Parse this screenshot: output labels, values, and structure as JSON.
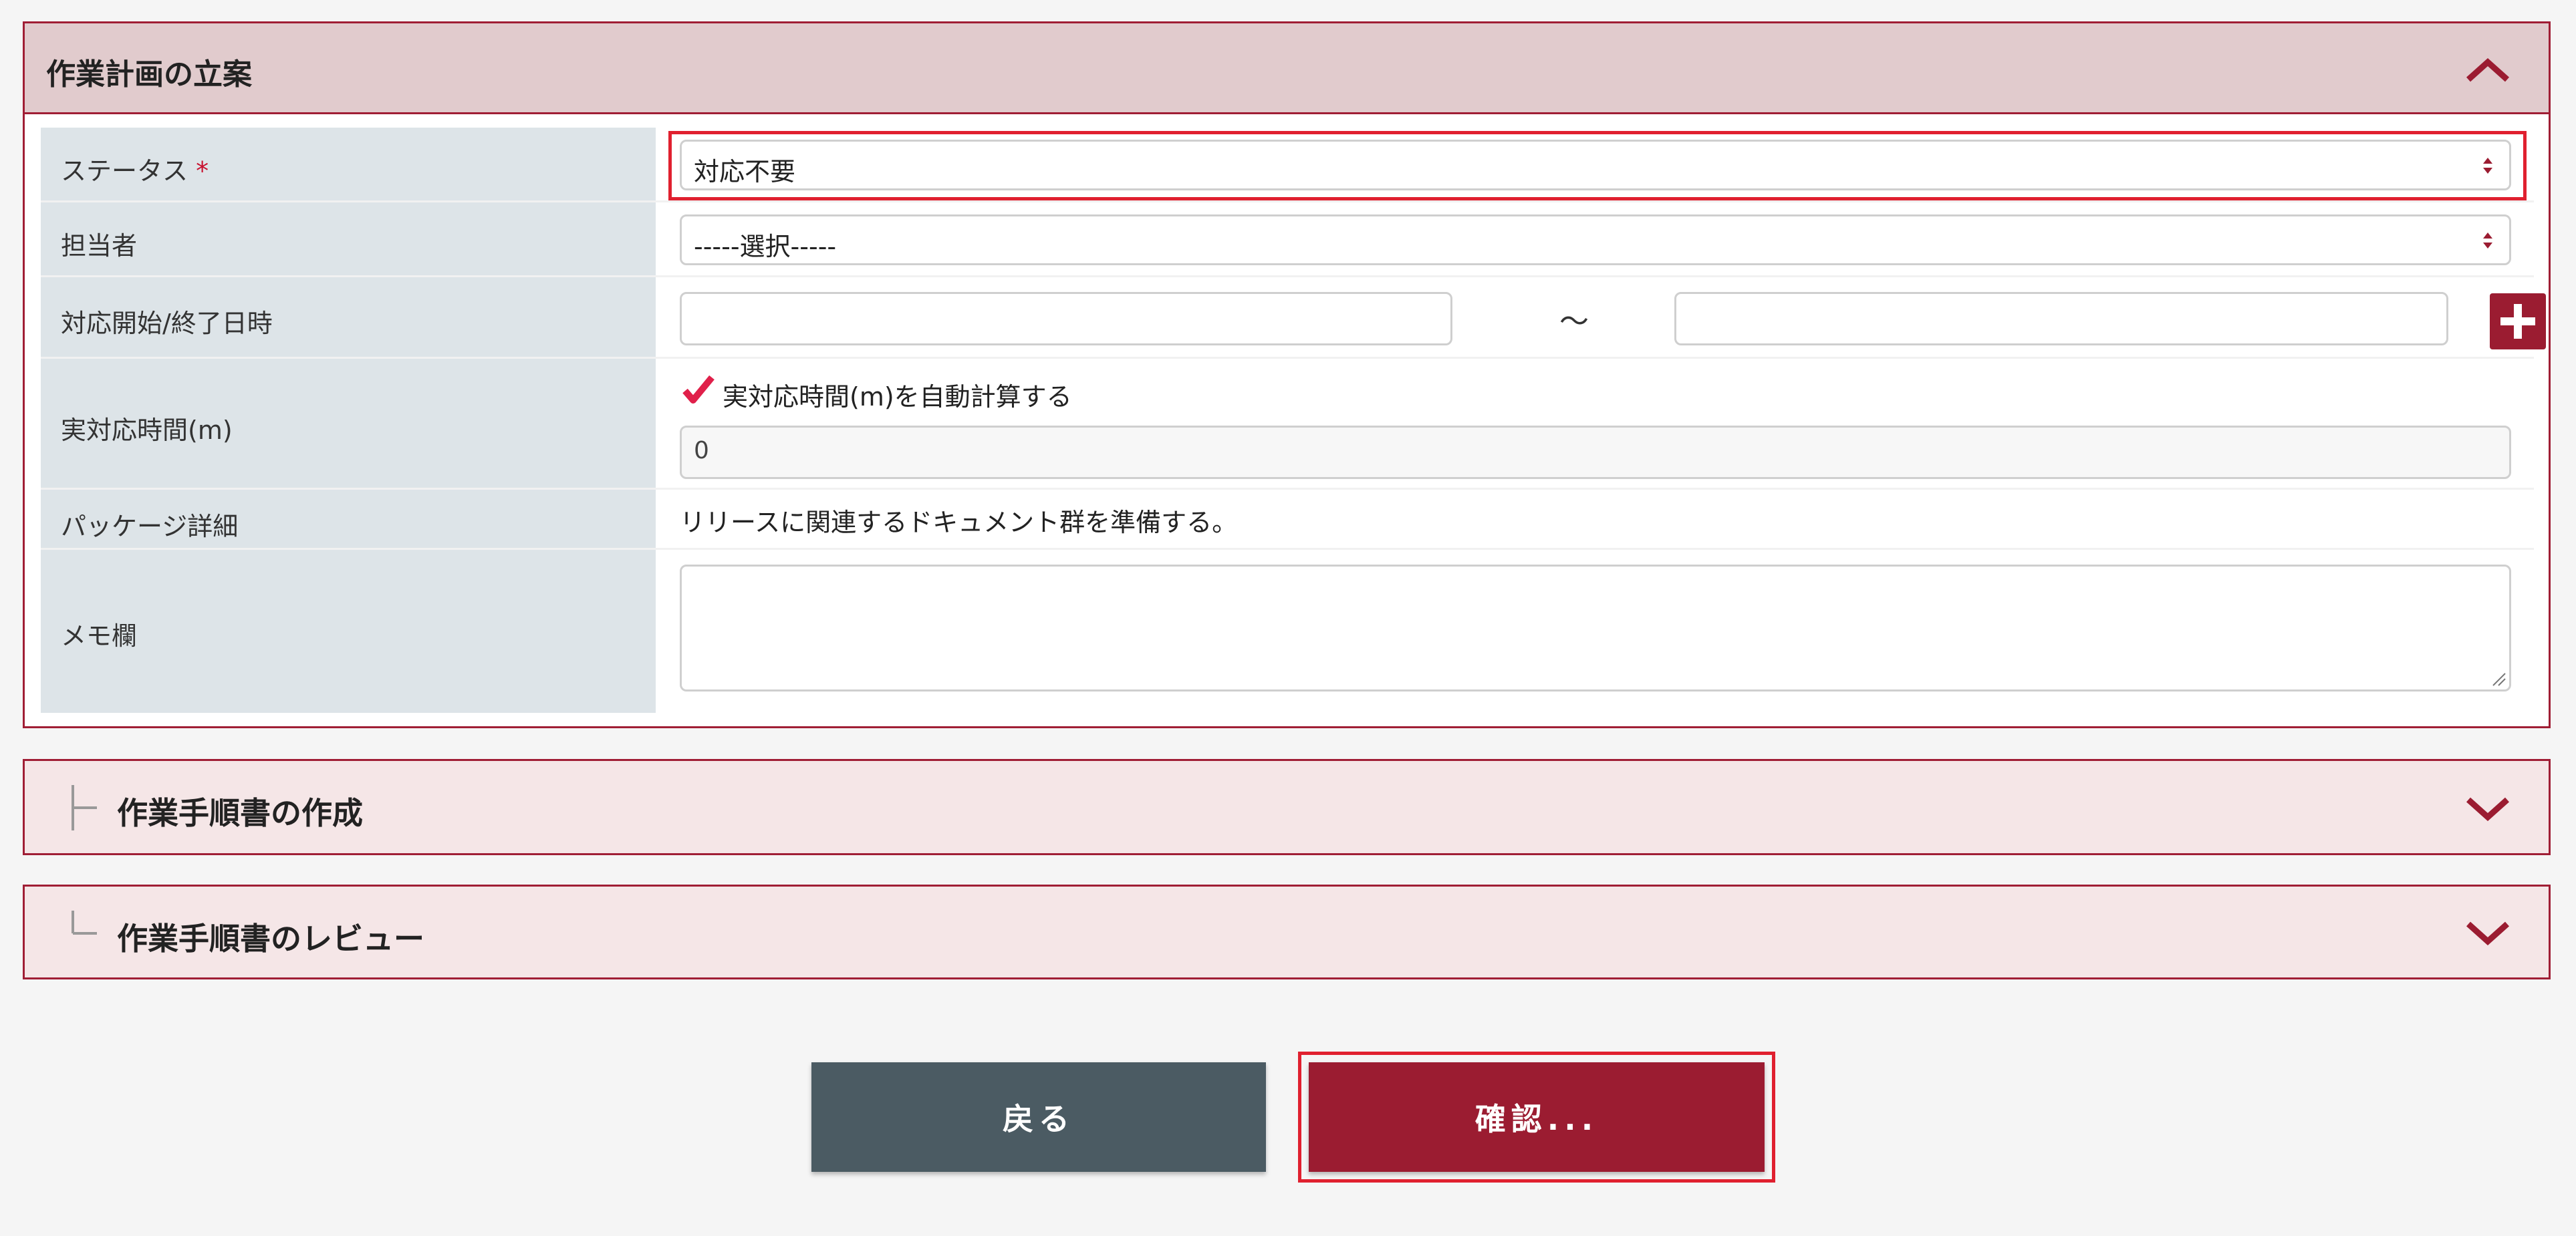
{
  "section_plan": {
    "title": "作業計画の立案",
    "fields": {
      "status": {
        "label": "ステータス",
        "required_mark": "*",
        "value": "対応不要"
      },
      "assignee": {
        "label": "担当者",
        "value": "-----選択-----"
      },
      "datetime": {
        "label": "対応開始/終了日時",
        "separator": "～",
        "start_value": "",
        "end_value": ""
      },
      "actual_time": {
        "label": "実対応時間(m)",
        "checkbox_label": "実対応時間(m)を自動計算する",
        "checked": true,
        "value": "0"
      },
      "package_detail": {
        "label": "パッケージ詳細",
        "value": "リリースに関連するドキュメント群を準備する。"
      },
      "memo": {
        "label": "メモ欄",
        "value": ""
      }
    }
  },
  "section_procedure": {
    "title": "作業手順書の作成"
  },
  "section_review": {
    "title": "作業手順書のレビュー"
  },
  "buttons": {
    "back": "戻る",
    "confirm": "確認..."
  },
  "colors": {
    "accent": "#9b1c31",
    "header_bg": "#e1cbcd",
    "label_bg": "#dde4e8",
    "back_button": "#4b5b63",
    "focus": "#e0202f"
  }
}
